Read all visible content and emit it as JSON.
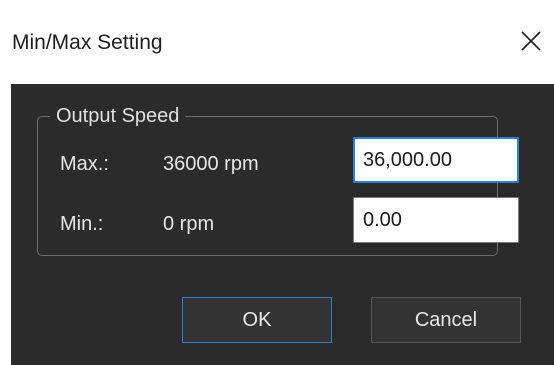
{
  "window": {
    "title": "Min/Max Setting",
    "close_glyph": "✕"
  },
  "group": {
    "legend": "Output Speed",
    "max": {
      "label": "Max.:",
      "value_text": "36000 rpm",
      "input_value": "36,000.00"
    },
    "min": {
      "label": "Min.:",
      "value_text": "0 rpm",
      "input_value": "0.00"
    }
  },
  "buttons": {
    "ok_label": "OK",
    "cancel_label": "Cancel"
  },
  "colors": {
    "background": "#2b2b2b",
    "accent": "#2f7fd4"
  },
  "icons": {
    "close": "close-icon"
  }
}
